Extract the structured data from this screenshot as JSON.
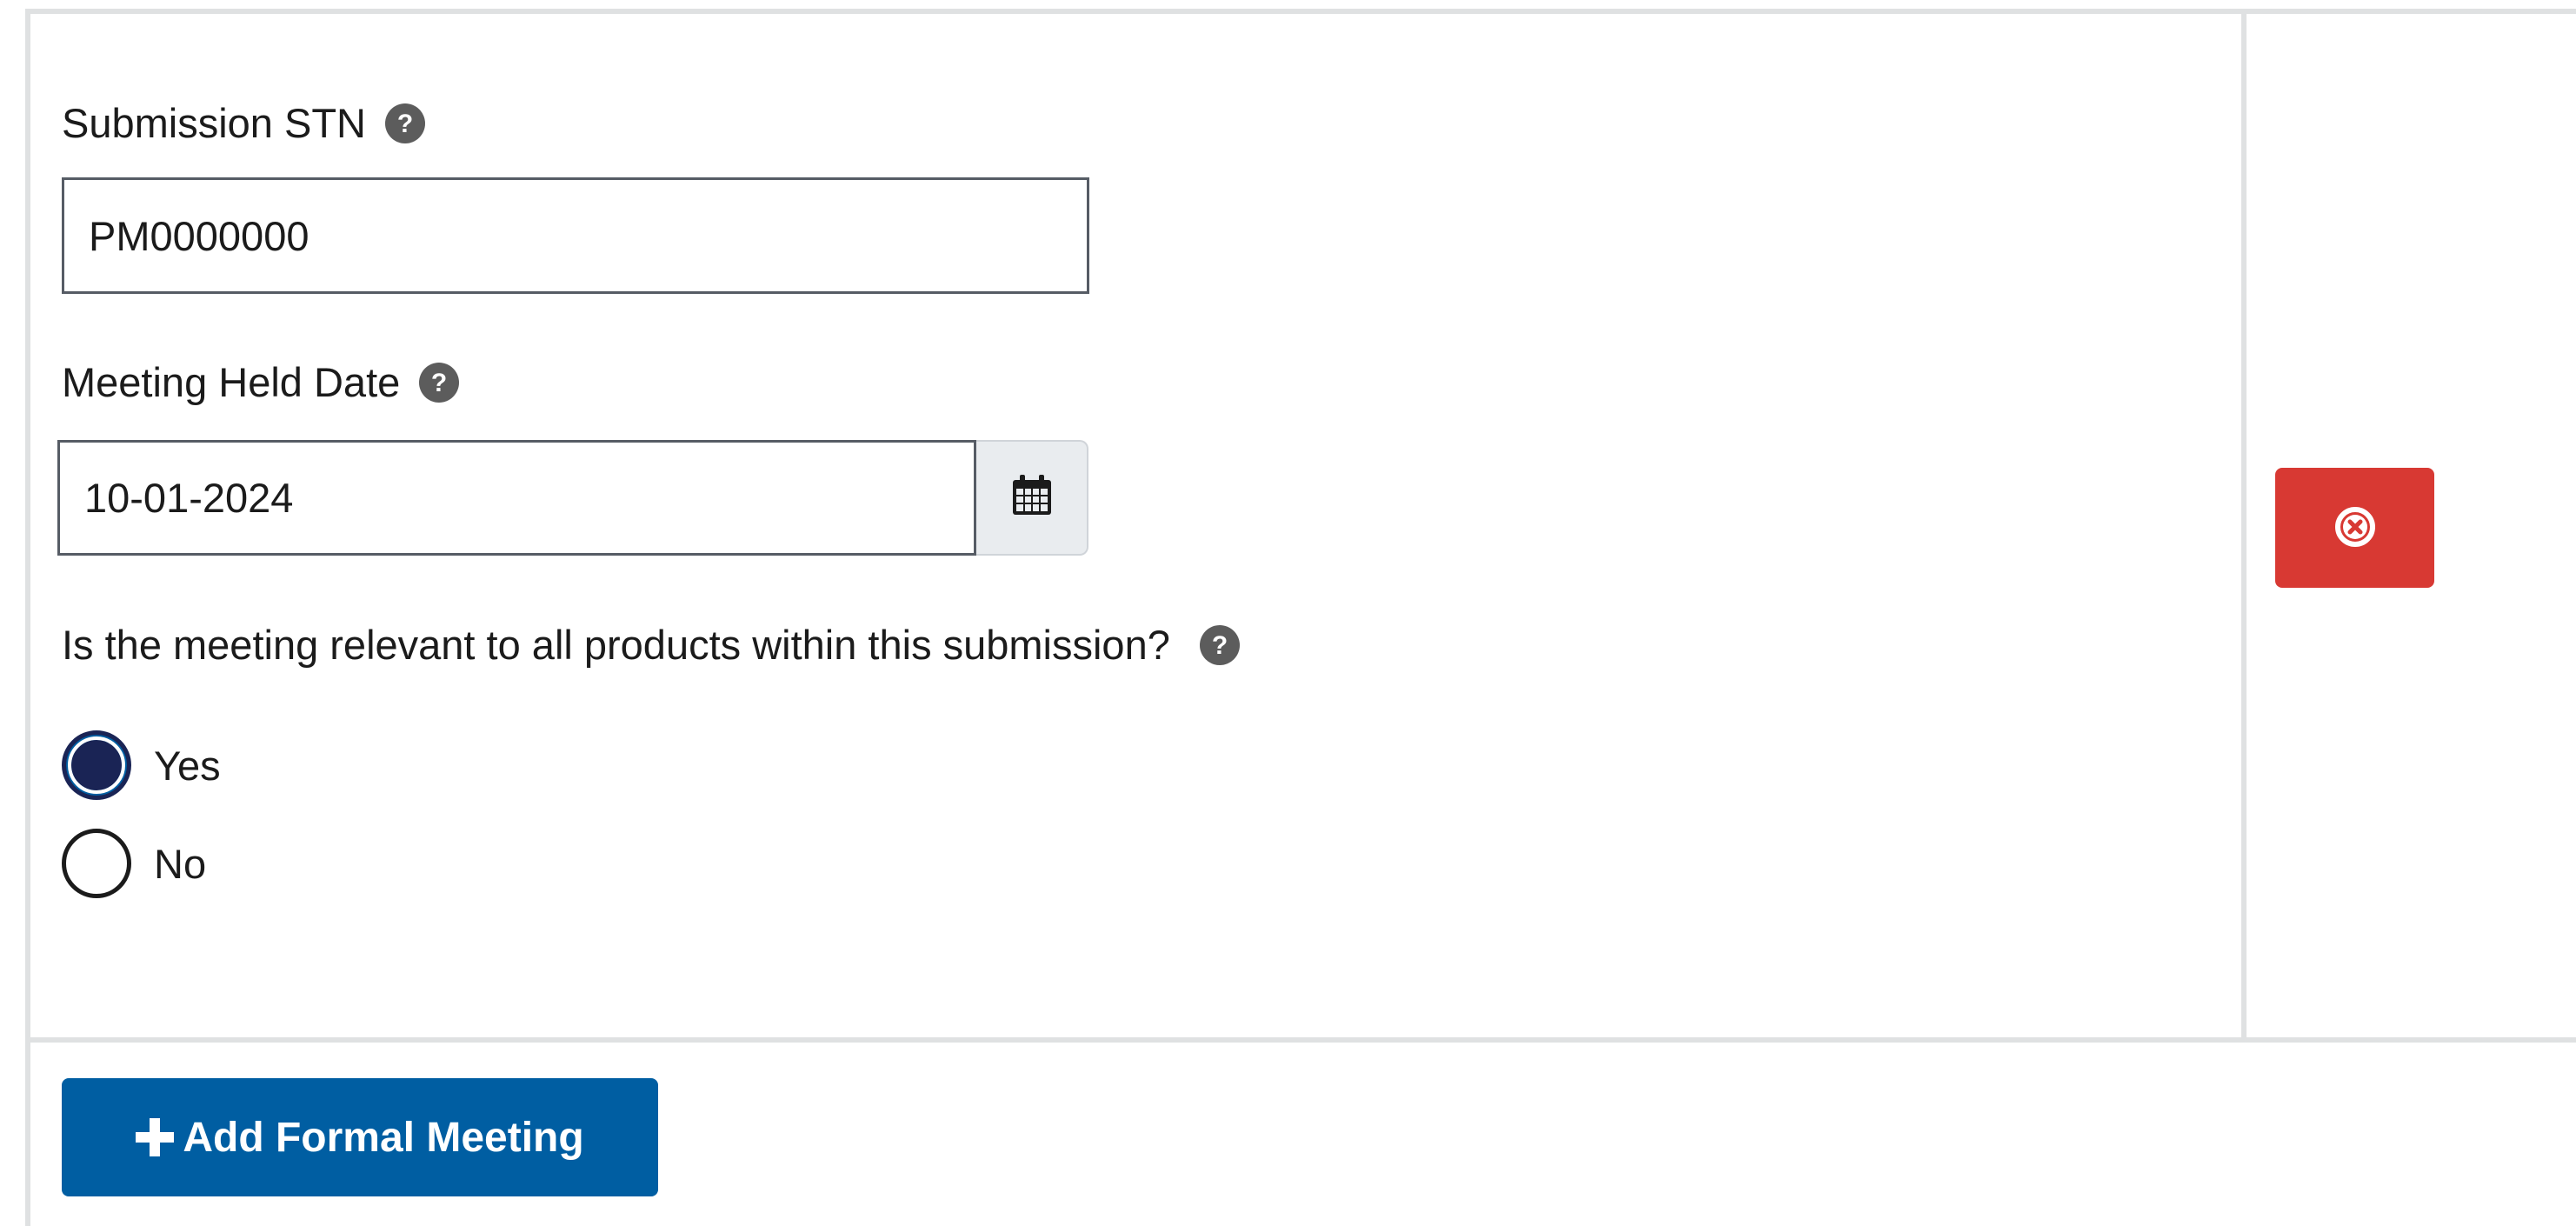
{
  "form": {
    "stn": {
      "label": "Submission STN",
      "value": "PM0000000",
      "help_icon": "question-circle-icon"
    },
    "meeting_date": {
      "label": "Meeting Held Date",
      "value": "10-01-2024",
      "help_icon": "question-circle-icon",
      "calendar_icon": "calendar-icon"
    },
    "relevance": {
      "question": "Is the meeting relevant to all products within this submission?",
      "help_icon": "question-circle-icon",
      "options": [
        {
          "label": "Yes",
          "checked": true
        },
        {
          "label": "No",
          "checked": false
        }
      ]
    }
  },
  "row_actions": {
    "remove_icon": "times-circle-icon",
    "remove_color": "#d83933"
  },
  "footer": {
    "add_button_label": "Add Formal Meeting",
    "add_icon": "plus-icon",
    "add_color": "#005ea2"
  },
  "colors": {
    "border": "#dfe1e2",
    "text": "#1b1b1b",
    "radio_checked": "#1a2455"
  }
}
